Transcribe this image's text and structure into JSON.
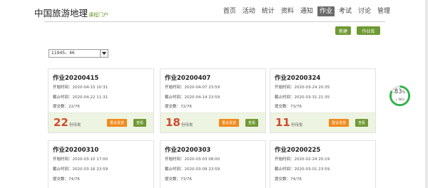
{
  "header": {
    "logo": "中国旅游地理",
    "logo_sub": "课程门户",
    "nav": [
      "首页",
      "活动",
      "统计",
      "资料",
      "通知",
      "作业",
      "考试",
      "讨论",
      "管理"
    ],
    "active_nav": "作业"
  },
  "actions": {
    "new_label": "新建",
    "library_label": "作业库"
  },
  "class_select": {
    "value": "11945、46"
  },
  "cards": [
    {
      "title": "作业20200415",
      "start_label": "开始时间：",
      "start": "2020-04-15 10:31",
      "end_label": "截止时间：",
      "end": "2020-04-22 11:31",
      "submit_label": "提交数：",
      "submit": "22/76",
      "pending": "22",
      "pending_label": "份待批",
      "resend": "重设发放",
      "view": "查看"
    },
    {
      "title": "作业20200407",
      "start_label": "开始时间：",
      "start": "2020-04-07 23:59",
      "end_label": "截止时间：",
      "end": "2020-04-14 23:59",
      "submit_label": "提交数：",
      "submit": "72/76",
      "pending": "18",
      "pending_label": "份待批",
      "resend": "重设发放",
      "view": "查看"
    },
    {
      "title": "作业20200324",
      "start_label": "开始时间：",
      "start": "2020-03-24 20:35",
      "end_label": "截止时间：",
      "end": "2020-03-31 21:35",
      "submit_label": "提交数：",
      "submit": "73/76",
      "pending": "11",
      "pending_label": "份待批",
      "resend": "重设发放",
      "view": "查看"
    },
    {
      "title": "作业20200310",
      "start_label": "开始时间：",
      "start": "2020-03-10 17:00",
      "end_label": "截止时间：",
      "end": "2020-03-16 23:59",
      "submit_label": "提交数：",
      "submit": "74/76"
    },
    {
      "title": "作业20200303",
      "start_label": "开始时间：",
      "start": "2020-03-03 08:00",
      "end_label": "截止时间：",
      "end": "2020-03-09 23:59",
      "submit_label": "提交数：",
      "submit": "73/76"
    },
    {
      "title": "作业20200225",
      "start_label": "开始时间：",
      "start": "2020-02-24 20:19",
      "end_label": "截止时间：",
      "end": "2020-03-01 23:59",
      "submit_label": "提交数：",
      "submit": "74/76"
    }
  ],
  "widget": {
    "percent": "83",
    "percent_sign": "%",
    "speed": "0K/s",
    "fraction": 0.83,
    "color": "#2fb34a"
  },
  "colors": {
    "accent_green": "#6f9a33",
    "pending_red": "#d04a2c",
    "resend_orange": "#f08a1a"
  }
}
